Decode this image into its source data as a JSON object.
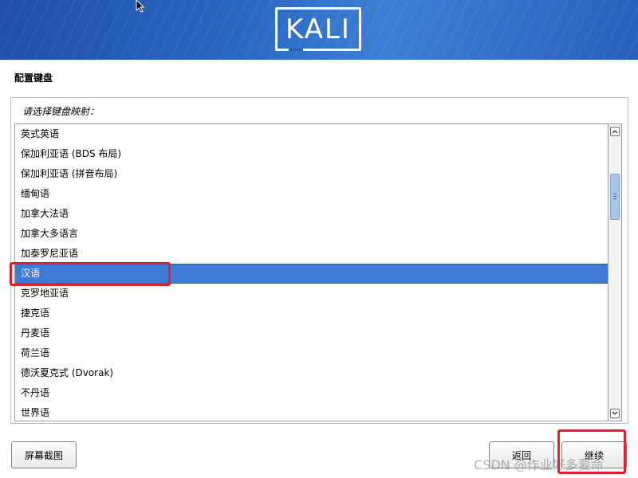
{
  "header": {
    "logo_text": "KALI"
  },
  "page": {
    "title": "配置键盘",
    "prompt": "请选择键盘映射："
  },
  "keymap_list": {
    "items": [
      "英式英语",
      "保加利亚语 (BDS 布局)",
      "保加利亚语 (拼音布局)",
      "缅甸语",
      "加拿大法语",
      "加拿大多语言",
      "加泰罗尼亚语",
      "汉语",
      "克罗地亚语",
      "捷克语",
      "丹麦语",
      "荷兰语",
      "德沃夏克式 (Dvorak)",
      "不丹语",
      "世界语"
    ],
    "selected": "汉语"
  },
  "buttons": {
    "screenshot": "屏幕截图",
    "back": "返回",
    "continue": "继续"
  },
  "watermark": "CSDN @作业好多要命",
  "colors": {
    "selection": "#3f7bd6",
    "annotation": "#e6202a",
    "header": "#2c68c4"
  }
}
